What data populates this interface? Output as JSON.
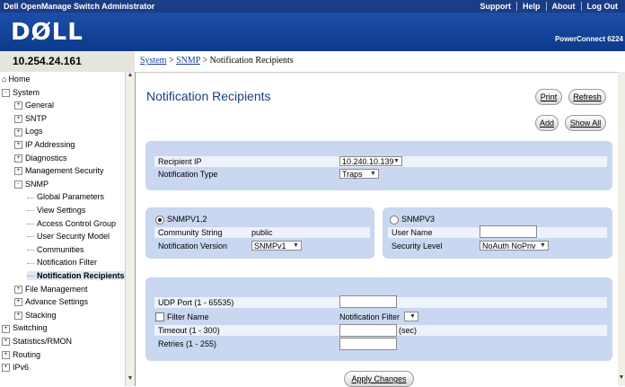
{
  "titlebar": {
    "app_title": "Dell OpenManage Switch Administrator",
    "links": [
      "Support",
      "Help",
      "About",
      "Log Out"
    ]
  },
  "banner": {
    "logo": "DØLL",
    "product": "PowerConnect 6224"
  },
  "address": {
    "ip": "10.254.24.161"
  },
  "breadcrumb": {
    "system": "System",
    "sep1": " > ",
    "snmp": "SNMP",
    "sep2": " > ",
    "current": "Notification Recipients"
  },
  "sidebar": {
    "items": [
      {
        "label": "Home",
        "level": 0,
        "pm": ""
      },
      {
        "label": "System",
        "level": 0,
        "pm": "-"
      },
      {
        "label": "General",
        "level": 1,
        "pm": "+"
      },
      {
        "label": "SNTP",
        "level": 1,
        "pm": "+"
      },
      {
        "label": "Logs",
        "level": 1,
        "pm": "+"
      },
      {
        "label": "IP Addressing",
        "level": 1,
        "pm": "+"
      },
      {
        "label": "Diagnostics",
        "level": 1,
        "pm": "+"
      },
      {
        "label": "Management Security",
        "level": 1,
        "pm": "+"
      },
      {
        "label": "SNMP",
        "level": 1,
        "pm": "-"
      },
      {
        "label": "Global Parameters",
        "level": 2,
        "pm": ""
      },
      {
        "label": "View Settings",
        "level": 2,
        "pm": ""
      },
      {
        "label": "Access Control Group",
        "level": 2,
        "pm": ""
      },
      {
        "label": "User Security Model",
        "level": 2,
        "pm": ""
      },
      {
        "label": "Communities",
        "level": 2,
        "pm": ""
      },
      {
        "label": "Notification Filter",
        "level": 2,
        "pm": ""
      },
      {
        "label": "Notification Recipients",
        "level": 2,
        "pm": "",
        "selected": true
      },
      {
        "label": "File Management",
        "level": 1,
        "pm": "+"
      },
      {
        "label": "Advance Settings",
        "level": 1,
        "pm": "+"
      },
      {
        "label": "Stacking",
        "level": 1,
        "pm": "+"
      },
      {
        "label": "Switching",
        "level": 0,
        "pm": "+"
      },
      {
        "label": "Statistics/RMON",
        "level": 0,
        "pm": "+"
      },
      {
        "label": "Routing",
        "level": 0,
        "pm": "+"
      },
      {
        "label": "IPv6",
        "level": 0,
        "pm": "+"
      }
    ]
  },
  "main": {
    "title": "Notification Recipients",
    "buttons": {
      "print": "Print",
      "refresh": "Refresh",
      "add": "Add",
      "show_all": "Show All",
      "apply": "Apply Changes"
    },
    "recipient": {
      "ip_label": "Recipient IP",
      "ip_value": "10.240.10.139",
      "type_label": "Notification Type",
      "type_value": "Traps"
    },
    "snmpv12": {
      "label": "SNMPV1,2",
      "community_label": "Community String",
      "community_value": "public",
      "version_label": "Notification Version",
      "version_value": "SNMPv1"
    },
    "snmpv3": {
      "label": "SNMPV3",
      "user_label": "User Name",
      "user_value": "",
      "security_label": "Security Level",
      "security_value": "NoAuth NoPriv"
    },
    "advanced": {
      "udp_label": "UDP Port (1 - 65535)",
      "udp_value": "",
      "filter_label": "Filter Name",
      "filter_value": "Notification Filter",
      "timeout_label": "Timeout (1 - 300)",
      "timeout_value": "",
      "timeout_unit": "(sec)",
      "retries_label": "Retries (1 - 255)",
      "retries_value": ""
    }
  }
}
